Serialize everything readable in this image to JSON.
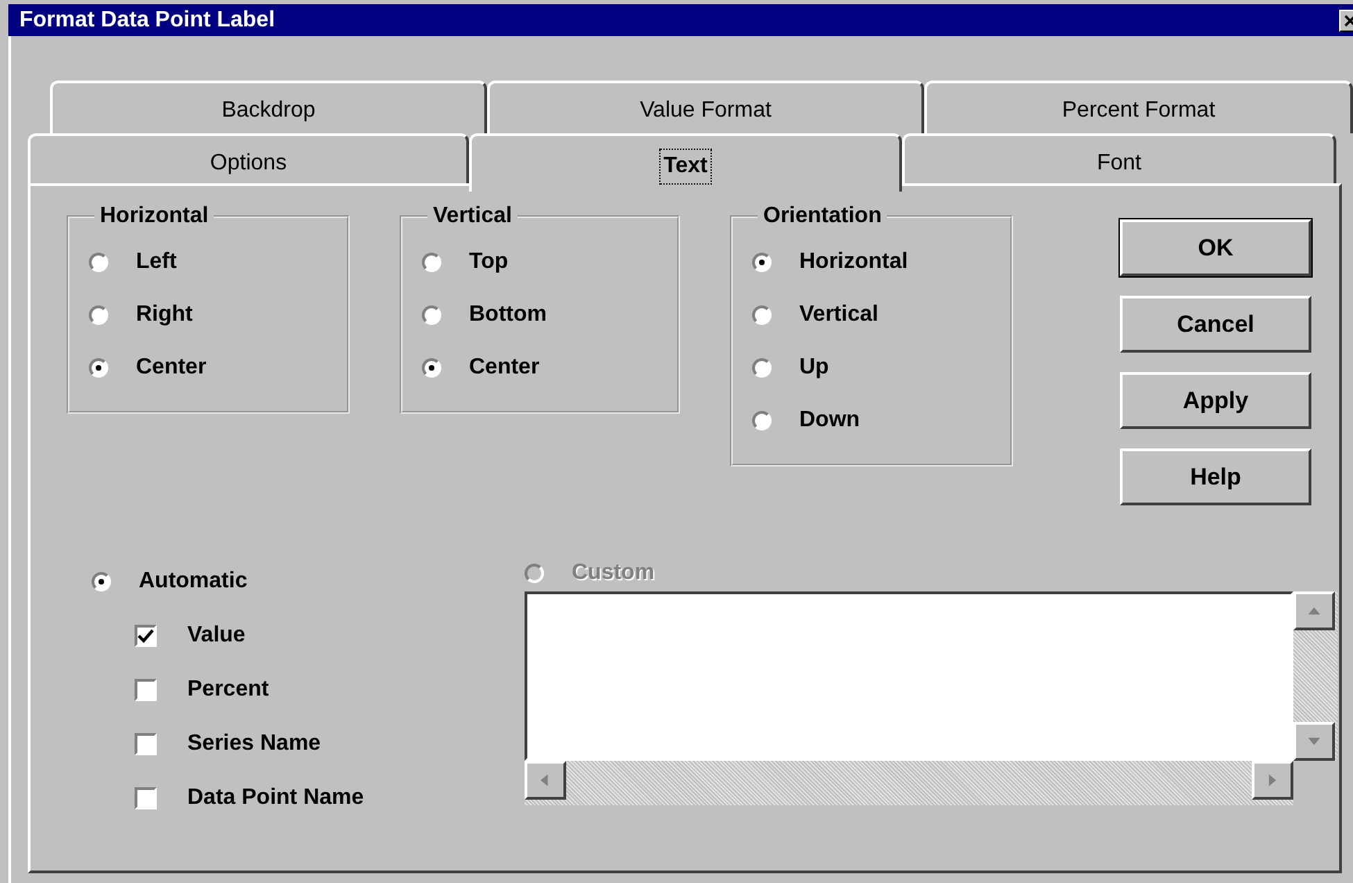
{
  "window": {
    "title": "Format Data Point Label"
  },
  "tab_rows": [
    [
      {
        "label": "Backdrop",
        "selected": false
      },
      {
        "label": "Value Format",
        "selected": false
      },
      {
        "label": "Percent Format",
        "selected": false
      }
    ],
    [
      {
        "label": "Options",
        "selected": false
      },
      {
        "label": "Text",
        "selected": true
      },
      {
        "label": "Font",
        "selected": false
      }
    ]
  ],
  "groups": [
    {
      "title": "Horizontal",
      "options": [
        {
          "label": "Left",
          "selected": false
        },
        {
          "label": "Right",
          "selected": false
        },
        {
          "label": "Center",
          "selected": true
        }
      ]
    },
    {
      "title": "Vertical",
      "options": [
        {
          "label": "Top",
          "selected": false
        },
        {
          "label": "Bottom",
          "selected": false
        },
        {
          "label": "Center",
          "selected": true
        }
      ]
    },
    {
      "title": "Orientation",
      "options": [
        {
          "label": "Horizontal",
          "selected": true
        },
        {
          "label": "Vertical",
          "selected": false
        },
        {
          "label": "Up",
          "selected": false
        },
        {
          "label": "Down",
          "selected": false
        }
      ]
    }
  ],
  "buttons": [
    {
      "label": "OK",
      "default": true
    },
    {
      "label": "Cancel",
      "default": false
    },
    {
      "label": "Apply",
      "default": false
    },
    {
      "label": "Help",
      "default": false
    }
  ],
  "automatic": {
    "label": "Automatic",
    "selected": true,
    "disabled": false
  },
  "fields": [
    {
      "label": "Value",
      "checked": true
    },
    {
      "label": "Percent",
      "checked": false
    },
    {
      "label": "Series Name",
      "checked": false
    },
    {
      "label": "Data Point Name",
      "checked": false
    }
  ],
  "custom": {
    "label": "Custom",
    "selected": false,
    "disabled": true
  }
}
